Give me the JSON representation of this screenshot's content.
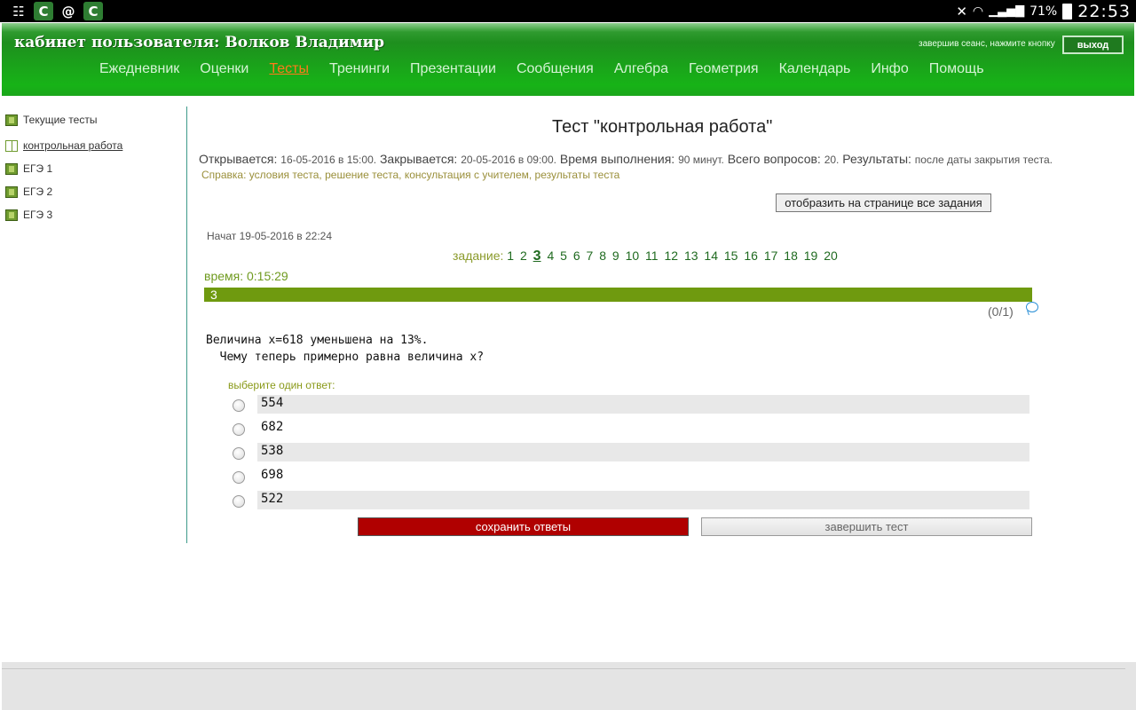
{
  "status_bar": {
    "left_icons": [
      {
        "name": "clear-notifications-icon",
        "glyph": "☷"
      },
      {
        "name": "app-c-icon",
        "glyph": "C"
      },
      {
        "name": "email-at-icon",
        "glyph": "@"
      },
      {
        "name": "app-c-icon-2",
        "glyph": "C"
      }
    ],
    "battery": "71%",
    "time": "22:53"
  },
  "header": {
    "user_title": "кабинет пользователя: Волков Владимир",
    "session_hint": "завершив сеанс, нажмите кнопку",
    "logout_label": "выход",
    "nav": [
      {
        "label": "Ежедневник",
        "active": false
      },
      {
        "label": "Оценки",
        "active": false
      },
      {
        "label": "Тесты",
        "active": true
      },
      {
        "label": "Тренинги",
        "active": false
      },
      {
        "label": "Презентации",
        "active": false
      },
      {
        "label": "Сообщения",
        "active": false
      },
      {
        "label": "Алгебра",
        "active": false
      },
      {
        "label": "Геометрия",
        "active": false
      },
      {
        "label": "Календарь",
        "active": false
      },
      {
        "label": "Инфо",
        "active": false
      },
      {
        "label": "Помощь",
        "active": false
      }
    ]
  },
  "sidebar": {
    "items": [
      {
        "label": "Текущие тесты",
        "open": false,
        "link": false
      },
      {
        "label": "контрольная работа",
        "open": true,
        "link": true
      },
      {
        "label": "ЕГЭ 1",
        "open": false,
        "link": false
      },
      {
        "label": "ЕГЭ 2",
        "open": false,
        "link": false
      },
      {
        "label": "ЕГЭ 3",
        "open": false,
        "link": false
      }
    ]
  },
  "test": {
    "title": "Тест \"контрольная работа\"",
    "opens_label": "Открывается:",
    "opens_value": "16-05-2016 в 15:00.",
    "closes_label": "Закрывается:",
    "closes_value": "20-05-2016 в 09:00.",
    "duration_label": "Время выполнения:",
    "duration_value": "90 минут.",
    "questions_label": "Всего вопросов:",
    "questions_value": "20.",
    "results_label": "Результаты:",
    "results_value": "после даты закрытия теста.",
    "help_label": "Справка:",
    "help_links": [
      "условия теста",
      "решение теста",
      "консультация с учителем",
      "результаты теста"
    ],
    "show_all_label": "отобразить на странице все задания",
    "started": "Начат 19-05-2016 в 22:24",
    "task_label": "задание:",
    "tasks": [
      "1",
      "2",
      "3",
      "4",
      "5",
      "6",
      "7",
      "8",
      "9",
      "10",
      "11",
      "12",
      "13",
      "14",
      "15",
      "16",
      "17",
      "18",
      "19",
      "20"
    ],
    "current_task": "3",
    "time_label": "время: 0:15:29",
    "question_number": "3",
    "score": "(0/1)",
    "question_text": "Величина x=618 уменьшена на 13%.\n  Чему теперь примерно равна величина x?",
    "choose_label": "выберите один ответ:",
    "answers": [
      "554",
      "682",
      "538",
      "698",
      "522"
    ],
    "save_label": "сохранить ответы",
    "finish_label": "завершить тест"
  },
  "colors": {
    "header_green": "#1aa61a",
    "active_tab": "#ff7a1a",
    "question_bar": "#6f9a0f",
    "save_button": "#b00000"
  }
}
